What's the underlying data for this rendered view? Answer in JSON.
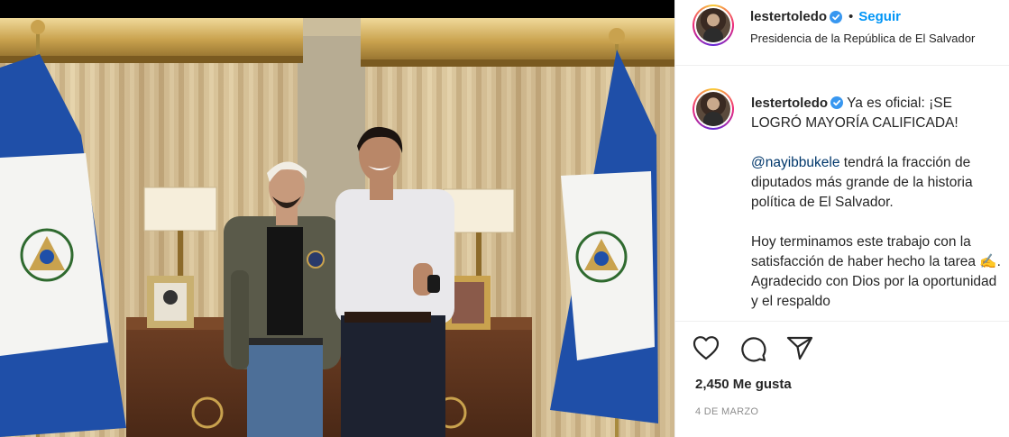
{
  "post": {
    "username": "lestertoledo",
    "follow_label": "Seguir",
    "dot": "•",
    "location": "Presidencia de la República de El Salvador",
    "caption_intro": "Ya es oficial: ¡SE LOGRÓ MAYORÍA CALIFICADA!",
    "mention": "@nayibbukele",
    "caption_p2": " tendrá la fracción de diputados más grande de la historia política de El Salvador.",
    "caption_p3": "Hoy terminamos este trabajo con la satisfacción de haber hecho la tarea ✍️.",
    "caption_p4": "Agradecido con Dios por la oportunidad y el respaldo",
    "likes": "2,450 Me gusta",
    "date": "4 DE MARZO"
  },
  "colors": {
    "accent": "#0095f6",
    "mention": "#00376b",
    "flag_blue": "#1f4fa8",
    "flag_white": "#f4f4f2",
    "gold": "#b8963e"
  },
  "icons": [
    "verified-badge-icon",
    "heart-icon",
    "comment-icon",
    "share-icon"
  ]
}
